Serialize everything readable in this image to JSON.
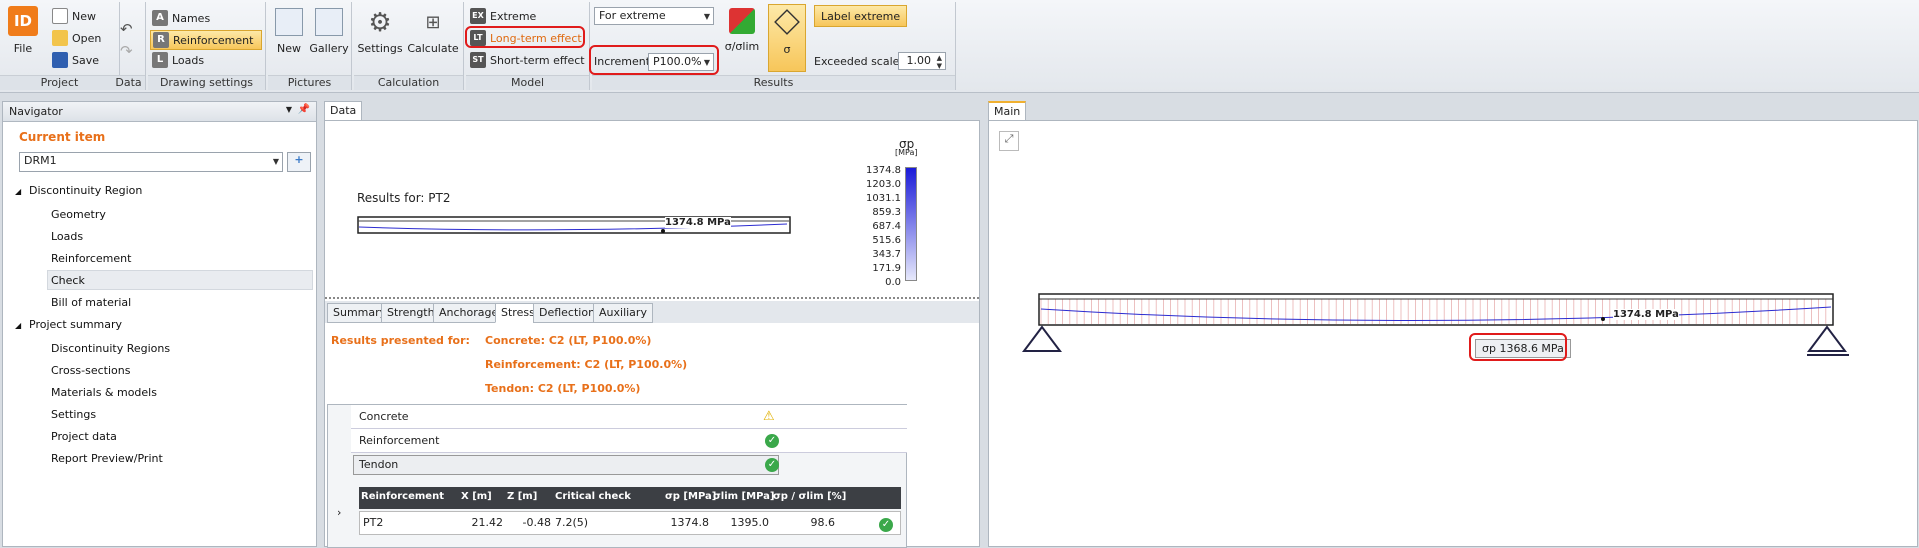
{
  "ribbon": {
    "file": "File",
    "new": "New",
    "open": "Open",
    "save": "Save",
    "names": "Names",
    "reinforcement": "Reinforcement",
    "loads": "Loads",
    "new_pic": "New",
    "gallery": "Gallery",
    "settings": "Settings",
    "calculate": "Calculate",
    "extreme": "Extreme",
    "long_term": "Long-term effect",
    "short_term": "Short-term effect",
    "for_extreme": "For extreme",
    "increment_label": "Increment",
    "increment_value": "P100.0%",
    "sigma_ratio": "σ/σlim",
    "sigma": "σ",
    "label_extreme": "Label extreme",
    "exceeded_scale_label": "Exceeded scale",
    "exceeded_scale_value": "1.00",
    "groups": {
      "project": "Project",
      "data": "Data",
      "drawing": "Drawing settings",
      "pictures": "Pictures",
      "calculation": "Calculation",
      "model": "Model",
      "results": "Results"
    }
  },
  "navigator": {
    "title": "Navigator",
    "current_item_label": "Current item",
    "current_item": "DRM1",
    "tree": [
      "Discontinuity Region",
      "Geometry",
      "Loads",
      "Reinforcement",
      "Check",
      "Bill of material",
      "Project summary",
      "Discontinuity Regions",
      "Cross-sections",
      "Materials & models",
      "Settings",
      "Project data",
      "Report Preview/Print"
    ]
  },
  "data_panel": {
    "tab": "Data",
    "results_for": "Results for: PT2",
    "beam_label": "1374.8 MPa",
    "scale_title": "σp",
    "scale_unit": "[MPa]",
    "scale_values": [
      "1374.8",
      "1203.0",
      "1031.1",
      "859.3",
      "687.4",
      "515.6",
      "343.7",
      "171.9",
      "0.0"
    ],
    "tabs": [
      "Summary",
      "Strength",
      "Anchorage",
      "Stress",
      "Deflection",
      "Auxiliary"
    ],
    "results_presented": "Results presented for:",
    "concrete_res": "Concrete: C2 (LT, P100.0%)",
    "reinf_res": "Reinforcement: C2 (LT, P100.0%)",
    "tendon_res": "Tendon: C2 (LT, P100.0%)",
    "rows": [
      "Concrete",
      "Reinforcement",
      "Tendon"
    ],
    "table": {
      "headers": [
        "Reinforcement",
        "X [m]",
        "Z [m]",
        "Critical check",
        "σp [MPa]",
        "σlim [MPa]",
        "σp / σlim [%]"
      ],
      "row": [
        "PT2",
        "21.42",
        "-0.48",
        "7.2(5)",
        "1374.8",
        "1395.0",
        "98.6"
      ]
    }
  },
  "main_panel": {
    "tab": "Main",
    "beam_label": "1374.8 MPa",
    "sigma_label": "σp 1368.6 MPa"
  }
}
